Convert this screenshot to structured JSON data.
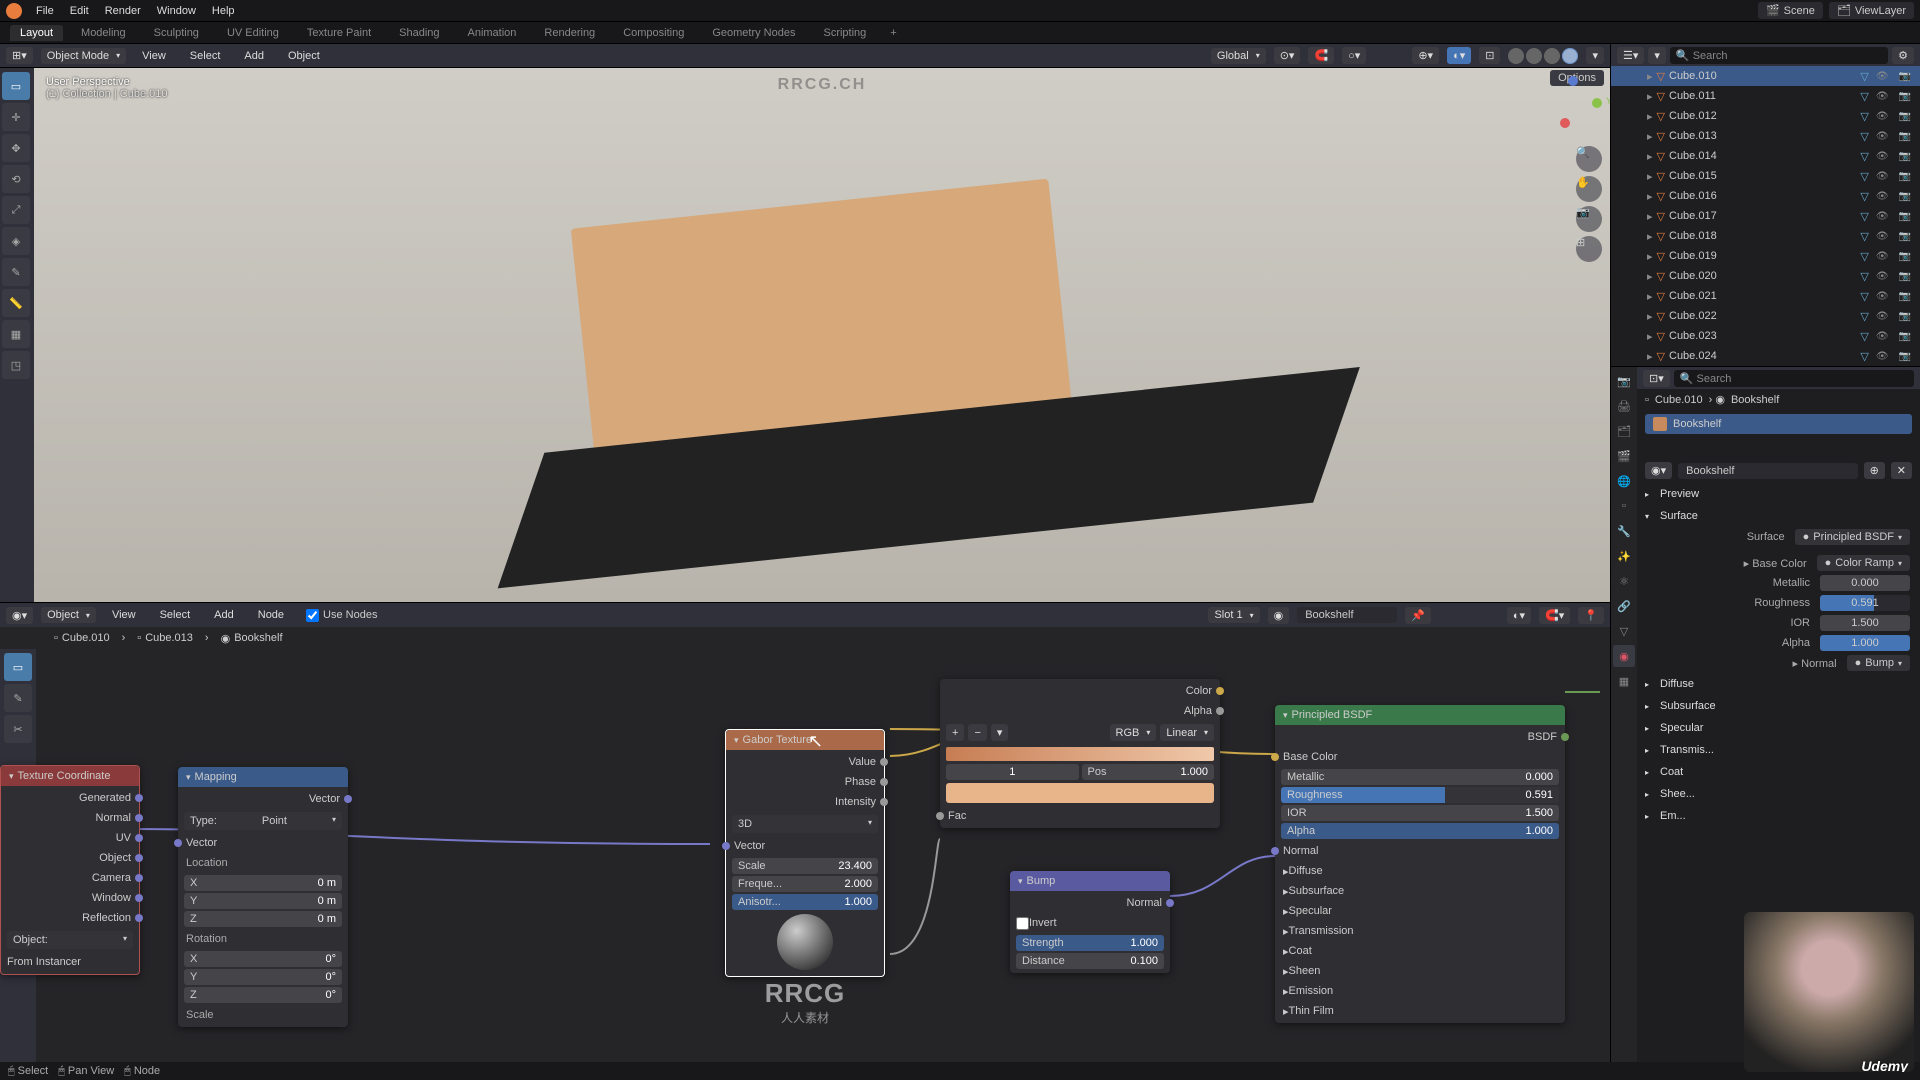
{
  "top_menu": {
    "items": [
      "File",
      "Edit",
      "Render",
      "Window",
      "Help"
    ]
  },
  "workspace_tabs": [
    "Layout",
    "Modeling",
    "Sculpting",
    "UV Editing",
    "Texture Paint",
    "Shading",
    "Animation",
    "Rendering",
    "Compositing",
    "Geometry Nodes",
    "Scripting"
  ],
  "active_workspace": "Layout",
  "scene_name": "Scene",
  "viewlayer_name": "ViewLayer",
  "viewport": {
    "mode": "Object Mode",
    "menus": [
      "View",
      "Select",
      "Add",
      "Object"
    ],
    "orientation": "Global",
    "options_label": "Options",
    "overlay_line1": "User Perspective",
    "overlay_line2": "(1) Collection | Cube.010",
    "faint_watermark": "RRCG.CH"
  },
  "node_editor": {
    "header_mode": "Object",
    "menus": [
      "View",
      "Select",
      "Add",
      "Node"
    ],
    "use_nodes_label": "Use Nodes",
    "slot_label": "Slot 1",
    "material_name": "Bookshelf",
    "breadcrumb": [
      "Cube.010",
      "Cube.013",
      "Bookshelf"
    ]
  },
  "nodes": {
    "texcoord": {
      "title": "Texture Coordinate",
      "outputs": [
        "Generated",
        "Normal",
        "UV",
        "Object",
        "Camera",
        "Window",
        "Reflection"
      ],
      "object_label": "Object:",
      "from_instancer": "From Instancer"
    },
    "mapping": {
      "title": "Mapping",
      "vector_out": "Vector",
      "type_label": "Type:",
      "type_value": "Point",
      "vector_in": "Vector",
      "loc_label": "Location",
      "loc": {
        "x_label": "X",
        "x_val": "0 m",
        "y_label": "Y",
        "y_val": "0 m",
        "z_label": "Z",
        "z_val": "0 m"
      },
      "rot_label": "Rotation",
      "rot": {
        "x_label": "X",
        "x_val": "0°",
        "y_label": "Y",
        "y_val": "0°",
        "z_label": "Z",
        "z_val": "0°"
      },
      "scale_label": "Scale"
    },
    "gabor": {
      "title": "Gabor Texture",
      "outs": [
        "Value",
        "Phase",
        "Intensity"
      ],
      "mode": "3D",
      "vector_in": "Vector",
      "scale_label": "Scale",
      "scale_val": "23.400",
      "freq_label": "Freque...",
      "freq_val": "2.000",
      "aniso_label": "Anisotr...",
      "aniso_val": "1.000"
    },
    "colorramp": {
      "add": "+",
      "sub": "−",
      "mode": "RGB",
      "interp": "Linear",
      "color": "Color",
      "alpha": "Alpha",
      "index": "1",
      "pos_label": "Pos",
      "pos_val": "1.000",
      "fac": "Fac"
    },
    "bump": {
      "title": "Bump",
      "normal_out": "Normal",
      "invert": "Invert",
      "strength_label": "Strength",
      "strength_val": "1.000",
      "distance_label": "Distance",
      "distance_val": "0.100"
    },
    "principled": {
      "title": "Principled BSDF",
      "bsdf": "BSDF",
      "base_color": "Base Color",
      "metallic": "Metallic",
      "metallic_val": "0.000",
      "roughness": "Roughness",
      "roughness_val": "0.591",
      "ior": "IOR",
      "ior_val": "1.500",
      "alpha": "Alpha",
      "alpha_val": "1.000",
      "normal": "Normal",
      "sections": [
        "Diffuse",
        "Subsurface",
        "Specular",
        "Transmission",
        "Coat",
        "Sheen",
        "Emission",
        "Thin Film"
      ]
    }
  },
  "outliner": {
    "search_placeholder": "Search",
    "items": [
      {
        "name": "Cube.010",
        "active": true
      },
      {
        "name": "Cube.011"
      },
      {
        "name": "Cube.012"
      },
      {
        "name": "Cube.013"
      },
      {
        "name": "Cube.014"
      },
      {
        "name": "Cube.015"
      },
      {
        "name": "Cube.016"
      },
      {
        "name": "Cube.017"
      },
      {
        "name": "Cube.018"
      },
      {
        "name": "Cube.019"
      },
      {
        "name": "Cube.020"
      },
      {
        "name": "Cube.021"
      },
      {
        "name": "Cube.022"
      },
      {
        "name": "Cube.023"
      },
      {
        "name": "Cube.024"
      }
    ]
  },
  "properties": {
    "search_placeholder": "Search",
    "breadcrumb_obj": "Cube.010",
    "breadcrumb_mat": "Bookshelf",
    "material_name": "Bookshelf",
    "mat_header": "Bookshelf",
    "preview": "Preview",
    "surface": "Surface",
    "surface_label": "Surface",
    "surface_val": "Principled BSDF",
    "basecolor_label": "Base Color",
    "basecolor_val": "Color Ramp",
    "metallic_label": "Metallic",
    "metallic_val": "0.000",
    "roughness_label": "Roughness",
    "roughness_val": "0.591",
    "ior_label": "IOR",
    "ior_val": "1.500",
    "alpha_label": "Alpha",
    "alpha_val": "1.000",
    "normal_label": "Normal",
    "normal_val": "Bump",
    "sections": [
      "Diffuse",
      "Subsurface",
      "Specular",
      "Transmis...",
      "Coat",
      "Shee...",
      "Em..."
    ]
  },
  "statusbar": {
    "select": "Select",
    "pan": "Pan View",
    "node": "Node"
  },
  "watermark": {
    "rr": "RRCG",
    "sub": "人人素材"
  },
  "webcam": {
    "label": "Udemy"
  }
}
